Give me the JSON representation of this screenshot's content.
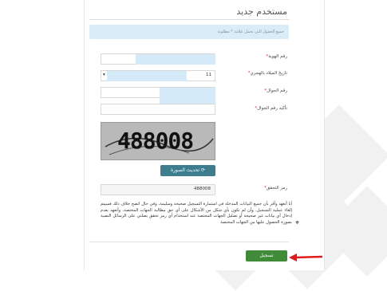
{
  "form": {
    "title": "مستخدم جديد",
    "info_text": "جميع الحقول التي تحمل علامة * مطلوبة",
    "fields": {
      "id_number": {
        "label": "رقم الهوية",
        "required_mark": "*"
      },
      "birth_date": {
        "label": "تاريخ الميلاد بالهجري",
        "required_mark": "*",
        "day_value": "11"
      },
      "mobile": {
        "label": "رقم الجوال",
        "required_mark": "*"
      },
      "mobile_confirm": {
        "label": "تأكيد رقم الجوال",
        "required_mark": "*"
      }
    },
    "captcha": {
      "image_text": "488008",
      "refresh_label": "تحديث الصورة",
      "code_label": "رمز التحقق",
      "code_value": "488008"
    },
    "notice": "أنا أتعهد وأقر بأن جميع البيانات المدخلة في استمارة التسجيل صحيحة وسليمة، وفي حال اتضح خلاف ذلك فسيتم إلغاء عملية التسجيل، وأن لم تكون بأي شكل من الأشكال على أي حق مطالبة الجهات المختصة، وأتعهد بعدم إدخال أي بيانات غير صحيحة أو تضليل الجهات المختصة عند استخدام أي رمز تحقق يصلني على الرسائل النصية بصورة الحصول عليها من الجهات المختصة",
    "submit_label": "تسجيل"
  },
  "colors": {
    "info_bg": "#d9ecf7",
    "refresh_button": "#3d7d8e",
    "submit_button": "#3f8b38",
    "arrow": "#e01b1b"
  }
}
